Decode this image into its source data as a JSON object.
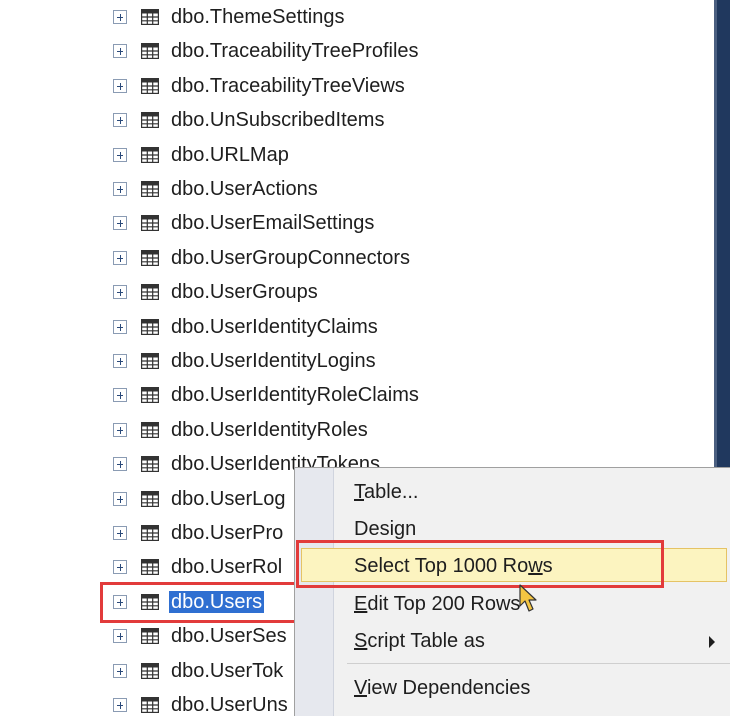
{
  "tree": {
    "rows": [
      {
        "label": "dbo.ThemeSettings"
      },
      {
        "label": "dbo.TraceabilityTreeProfiles"
      },
      {
        "label": "dbo.TraceabilityTreeViews"
      },
      {
        "label": "dbo.UnSubscribedItems"
      },
      {
        "label": "dbo.URLMap"
      },
      {
        "label": "dbo.UserActions"
      },
      {
        "label": "dbo.UserEmailSettings"
      },
      {
        "label": "dbo.UserGroupConnectors"
      },
      {
        "label": "dbo.UserGroups"
      },
      {
        "label": "dbo.UserIdentityClaims"
      },
      {
        "label": "dbo.UserIdentityLogins"
      },
      {
        "label": "dbo.UserIdentityRoleClaims"
      },
      {
        "label": "dbo.UserIdentityRoles"
      },
      {
        "label": "dbo.UserIdentityTokens"
      },
      {
        "label": "dbo.UserLog"
      },
      {
        "label": "dbo.UserPro"
      },
      {
        "label": "dbo.UserRol"
      },
      {
        "label": "dbo.Users",
        "selected": true
      },
      {
        "label": "dbo.UserSes"
      },
      {
        "label": "dbo.UserTok"
      },
      {
        "label": "dbo.UserUns"
      }
    ]
  },
  "context_menu": {
    "items": [
      {
        "label": "Table...",
        "accel": "T",
        "rest": "able..."
      },
      {
        "label": "Design",
        "accel": "",
        "rest": "Design"
      },
      {
        "label": "Select Top 1000 Rows",
        "pre": "Select Top 1000 Ro",
        "accel": "w",
        "post": "s",
        "active": true
      },
      {
        "label": "Edit Top 200 Rows",
        "accel": "E",
        "rest": "dit Top 200 Rows"
      },
      {
        "label": "Script Table as",
        "accel": "S",
        "rest": "cript Table as",
        "submenu": true
      },
      {
        "label": "View Dependencies",
        "accel": "V",
        "rest": "iew Dependencies"
      }
    ]
  },
  "colors": {
    "selection": "#2f6fd1",
    "highlight_box": "#e23b3b",
    "menu_active": "#fcf4c0"
  }
}
